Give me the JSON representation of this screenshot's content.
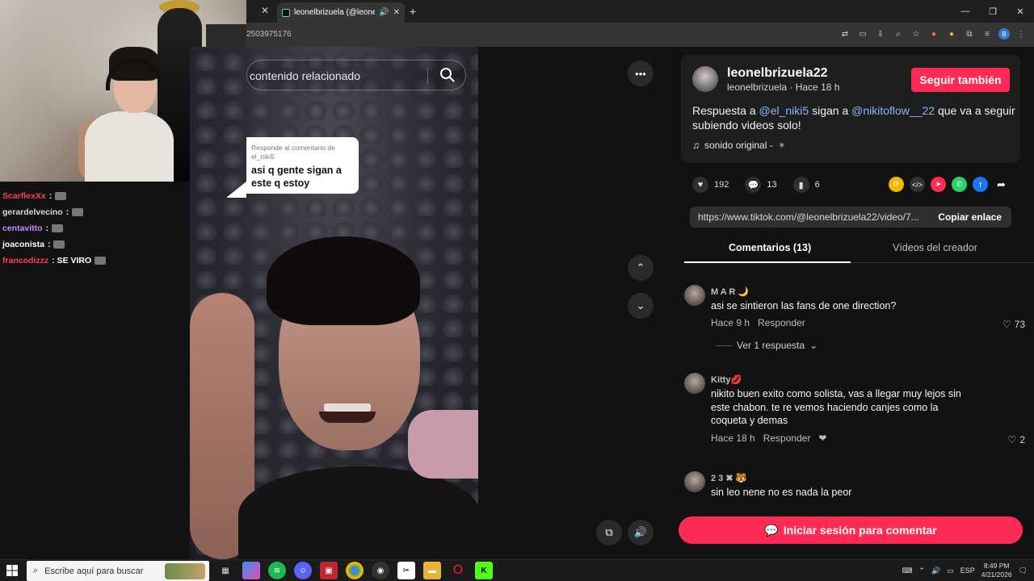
{
  "browser": {
    "tab_title": "leonelbrizuela (@leonelbrizi",
    "url": "2503975176"
  },
  "stream": {
    "chat": [
      {
        "user": "ScarflexXx",
        "text": ":",
        "color": "#ff3b5c"
      },
      {
        "user": "gerardelvecino",
        "text": ":",
        "color": "#d8d8d8"
      },
      {
        "user": "centavitto",
        "text": ":",
        "color": "#c08cff"
      },
      {
        "user": "joaconista",
        "text": ":",
        "color": "#ffffff"
      },
      {
        "user": "francodizzz",
        "text": ": SE VIRO",
        "color": "#ff3b5c"
      }
    ]
  },
  "video": {
    "search_placeholder": "contenido relacionado",
    "reply_sub": "Responde al comentario de el_niki5",
    "reply_text": "asi q gente sigan a este q estoy"
  },
  "post": {
    "username": "leonelbrizuela22",
    "subline": "leonelbrizuela · Hace 18 h",
    "follow_label": "Seguir también",
    "desc_pre": "Respuesta a ",
    "mention1": "@el_niki5",
    "desc_mid": " sigan a ",
    "mention2": "@nikitoflow__22",
    "desc_post": " que va a seguir subiendo videos solo!",
    "sound": "sonido original -",
    "likes": "192",
    "comments": "13",
    "saves": "6",
    "link": "https://www.tiktok.com/@leonelbrizuela22/video/7...",
    "copy_label": "Copiar enlace",
    "tab_comments": "Comentarios (13)",
    "tab_creator": "Vídeos del creador",
    "login_label": "Iniciar sesión para comentar"
  },
  "comments": [
    {
      "name": "M A R 🌙",
      "text": "asi se sintieron las fans de one direction?",
      "time": "Hace 9 h",
      "reply": "Responder",
      "likes": "73",
      "more": "Ver 1 respuesta"
    },
    {
      "name": "Kitty💋",
      "text": "nikito buen exito como solista, vas a llegar muy lejos sin este chabon. te re vemos haciendo canjes como la coqueta y demas",
      "time": "Hace 18 h",
      "reply": "Responder",
      "likes": "2"
    },
    {
      "name": "2 3 ✖ 🐯",
      "text": "sin leo nene no es nada la peor"
    }
  ],
  "taskbar": {
    "search_placeholder": "Escribe aquí para buscar",
    "lang": "ESP",
    "time": "8:49 PM",
    "date": "4/21/2026"
  },
  "colors": {
    "accent": "#fe2c55",
    "mention": "#8ab4f8"
  }
}
